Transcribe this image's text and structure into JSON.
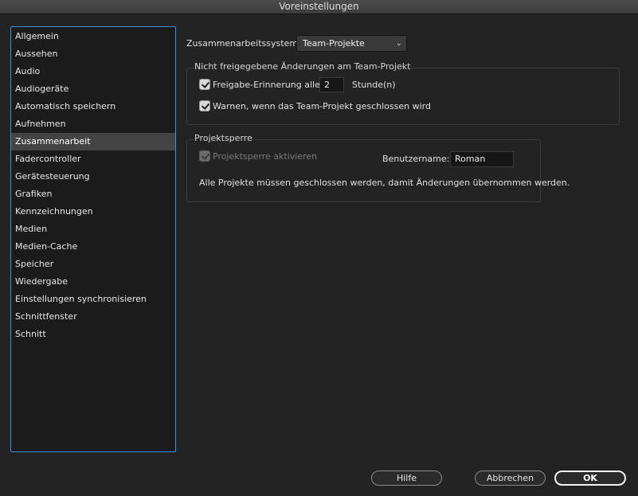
{
  "window": {
    "title": "Voreinstellungen"
  },
  "sidebar": {
    "items": [
      {
        "label": "Allgemein",
        "selected": false
      },
      {
        "label": "Aussehen",
        "selected": false
      },
      {
        "label": "Audio",
        "selected": false
      },
      {
        "label": "Audiogeräte",
        "selected": false
      },
      {
        "label": "Automatisch speichern",
        "selected": false
      },
      {
        "label": "Aufnehmen",
        "selected": false
      },
      {
        "label": "Zusammenarbeit",
        "selected": true
      },
      {
        "label": "Fadercontroller",
        "selected": false
      },
      {
        "label": "Gerätesteuerung",
        "selected": false
      },
      {
        "label": "Grafiken",
        "selected": false
      },
      {
        "label": "Kennzeichnungen",
        "selected": false
      },
      {
        "label": "Medien",
        "selected": false
      },
      {
        "label": "Medien-Cache",
        "selected": false
      },
      {
        "label": "Speicher",
        "selected": false
      },
      {
        "label": "Wiedergabe",
        "selected": false
      },
      {
        "label": "Einstellungen synchronisieren",
        "selected": false
      },
      {
        "label": "Schnittfenster",
        "selected": false
      },
      {
        "label": "Schnitt",
        "selected": false
      }
    ]
  },
  "collab": {
    "system_label": "Zusammenarbeitssystem:",
    "system_value": "Team-Projekte",
    "system_icon": "chevron-down-icon"
  },
  "unshared": {
    "title": "Nicht freigegebene Änderungen am Team-Projekt",
    "reminder_label": "Freigabe-Erinnerung alle:",
    "reminder_checked": true,
    "reminder_value": "2",
    "reminder_unit": "Stunde(n)",
    "warn_label": "Warnen, wenn das Team-Projekt geschlossen wird",
    "warn_checked": true
  },
  "lock": {
    "title": "Projektsperre",
    "enable_label": "Projektsperre aktivieren",
    "enable_checked": true,
    "enable_disabled": true,
    "username_label": "Benutzername:",
    "username_value": "Roman",
    "note": "Alle Projekte müssen geschlossen werden, damit Änderungen übernommen werden."
  },
  "buttons": {
    "help": "Hilfe",
    "cancel": "Abbrechen",
    "ok": "OK"
  },
  "colors": {
    "background": "#232323",
    "sidebar_bg": "#1b1b1b",
    "focus_ring": "#3d8ddc",
    "selected_item": "#444444"
  }
}
